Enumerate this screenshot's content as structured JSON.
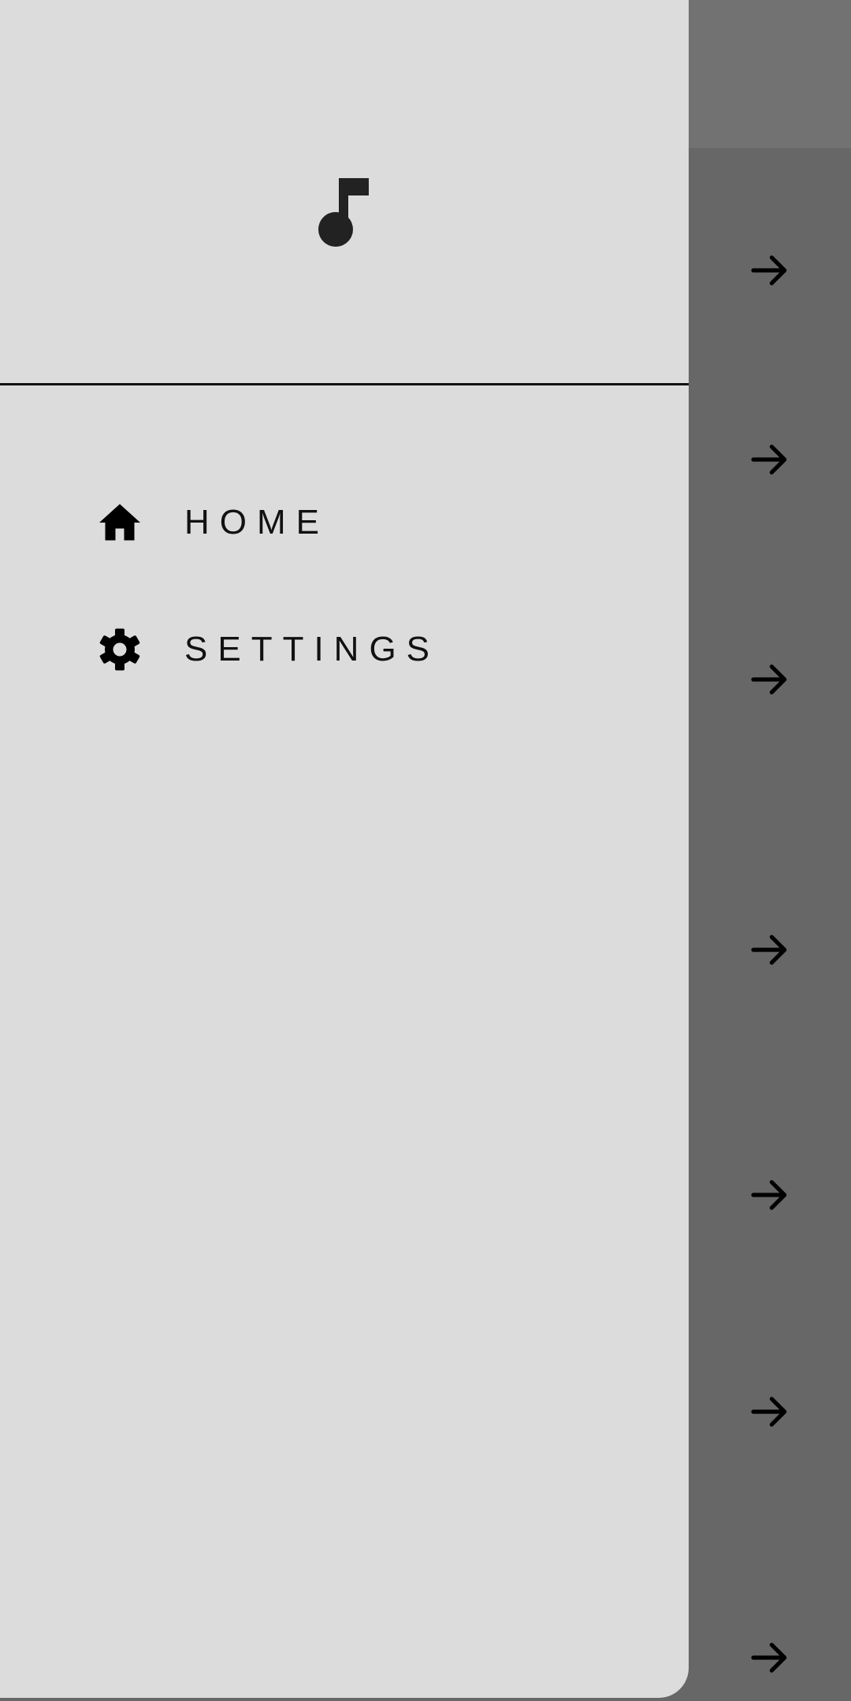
{
  "colors": {
    "drawer_background": "#dcdcdc",
    "scrim": "#676767",
    "topbar_scrim": "#727272",
    "text": "#111111",
    "icon": "#222222"
  },
  "drawer": {
    "header_icon": "music-note-icon",
    "items": [
      {
        "label": "HOME",
        "icon": "home-icon"
      },
      {
        "label": "SETTINGS",
        "icon": "gear-icon"
      }
    ]
  },
  "background_list": {
    "row_icon": "arrow-right-icon",
    "row_count": 7
  }
}
